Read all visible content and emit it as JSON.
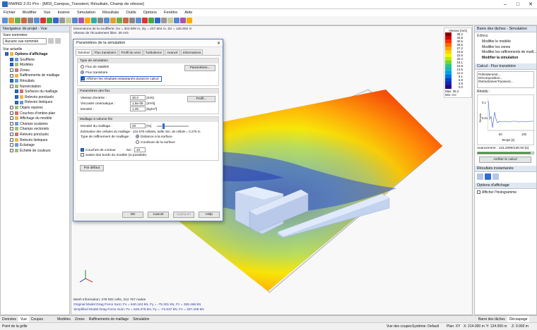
{
  "window": {
    "title": "RWIND 2.01 Pro - [M03_Campus_Transient, Résultats, Champ de vitesse]"
  },
  "menu": [
    "Fichier",
    "Modifier",
    "Vue",
    "Insérer",
    "Simulation",
    "Résultats",
    "Outils",
    "Options",
    "Fenêtre",
    "Aide"
  ],
  "left_panel": {
    "title": "Navigateur de projet - Vue",
    "saved_views_label": "Vues nommées",
    "saved_views_value": "Aucune vue nommée",
    "current_view_label": "Vue actuelle",
    "tree": [
      {
        "label": "Options d'affichage",
        "bold": true,
        "level": 0,
        "checked": true
      },
      {
        "label": "Soufflerie",
        "level": 1,
        "checked": true
      },
      {
        "label": "Modèles",
        "level": 1,
        "checked": true
      },
      {
        "label": "Zones",
        "level": 1,
        "checked": false
      },
      {
        "label": "Raffinements de maillage",
        "level": 1,
        "checked": false
      },
      {
        "label": "Résultats",
        "level": 1,
        "checked": true
      },
      {
        "label": "Numérotation",
        "level": 1,
        "checked": false
      },
      {
        "label": "Surfaces du maillage",
        "level": 2,
        "checked": true
      },
      {
        "label": "Relevés ponctuels",
        "level": 2,
        "checked": true
      },
      {
        "label": "Relevés linéiques",
        "level": 2,
        "checked": true
      },
      {
        "label": "Objets repères",
        "level": 1,
        "checked": false
      },
      {
        "label": "Couches d'ombre-plan",
        "level": 1,
        "checked": false
      },
      {
        "label": "Affichage du modèle",
        "level": 1,
        "checked": false
      },
      {
        "label": "Champs scalaires",
        "level": 1,
        "checked": false
      },
      {
        "label": "Champs vectoriels",
        "level": 1,
        "checked": false
      },
      {
        "label": "Relevés ponctuels",
        "level": 1,
        "checked": false
      },
      {
        "label": "Relevés linéiques",
        "level": 1,
        "checked": false
      },
      {
        "label": "Éclairage",
        "level": 1,
        "checked": false
      },
      {
        "label": "Échelle de couleurs",
        "level": 1,
        "checked": false
      }
    ]
  },
  "viewport": {
    "info1": "Dimensions de la soufflerie: Dx = 303.909 m, Dy = 207.604 m, Dz = 125.902 m",
    "info2": "Vitesse de l'écoulement libre: 30 m/s",
    "legend_title": "Vitesse [m/s]",
    "legend": [
      {
        "v": "36.2",
        "c": "#8b0000"
      },
      {
        "v": "34.8",
        "c": "#d40000"
      },
      {
        "v": "30.6",
        "c": "#ff2a00"
      },
      {
        "v": "29.5",
        "c": "#ff6a00"
      },
      {
        "v": "27.2",
        "c": "#ffa000"
      },
      {
        "v": "24.9",
        "c": "#ffd000"
      },
      {
        "v": "22.6",
        "c": "#f5f500"
      },
      {
        "v": "20.4",
        "c": "#b8e800"
      },
      {
        "v": "18.1",
        "c": "#6ad83a"
      },
      {
        "v": "15.8",
        "c": "#2cc48a"
      },
      {
        "v": "13.6",
        "c": "#18b4c8"
      },
      {
        "v": "11.3",
        "c": "#00a0e6"
      },
      {
        "v": "9.1",
        "c": "#0070e0"
      },
      {
        "v": "6.8",
        "c": "#0040d0"
      },
      {
        "v": "3.9",
        "c": "#1a20b0"
      },
      {
        "v": "0.0",
        "c": "#280088"
      }
    ],
    "legend_max": "Max:  36.2",
    "legend_min": "Min:  0.0",
    "bottom1": "Mesh information: 279 002 cells, 312 767 nodes",
    "bottom2": "Original Model Drag Force Sum: Fx = 640.163 kN, Fy = -75.301 kN, Fz = 326.468 kN",
    "bottom3": "Simplified Model Drag Force Sum: Fx = 625.378 kN, Fy = -74.637 kN, Fz = 337.209 kN"
  },
  "dialog": {
    "title": "Paramètres de la simulation",
    "tabs": [
      "Général",
      "Flux transitoire",
      "Profil du vent",
      "Turbulence",
      "Avancé",
      "Informations"
    ],
    "sim_type_header": "Type de simulation",
    "steady": "Flux de stabilité",
    "transient": "Flux transitoire",
    "params_button": "Paramètres...",
    "show_results": "Afficher les résultats instantanés durant le calcul",
    "flow_header": "Paramètres des flux",
    "speed_label": "Vitesse d'entrée :",
    "speed_val": "30.0",
    "speed_unit": "[m/s]",
    "profile_button": "Profil...",
    "visc_label": "Viscosité cinématique :",
    "visc_val": "1.5e-05",
    "visc_unit": "[m²/s]",
    "dens_label": "Densité :",
    "dens_val": "1.25",
    "dens_unit": "[kg/m³]",
    "mesh_header": "Maillage à volume fini",
    "mesh_density_label": "Densité du maillage :",
    "mesh_density_val": "20",
    "mesh_density_unit": "[%]",
    "estimation": "Estimation des cellules du maillage : 134 678 cellules, taille min. de cellule = 0.275 m",
    "refine_label": "Type de raffinement de maillage :",
    "refine_opt1": "Distance à la surface",
    "refine_opt2": "Courbure de la surface",
    "boundary_label": "Couches de contour",
    "nc_label": "NC :",
    "nc_val": "10",
    "consider_edges": "Saisie des bords du modèle (si possible)",
    "default_button": "Par défaut",
    "ok": "OK",
    "cancel": "Cancel",
    "apply": "Appliquer",
    "help": "Help"
  },
  "right_panel": {
    "title": "Barre des tâches - Simulation",
    "edit_header": "Éditeur",
    "edit_items": [
      "Modifier le modèle",
      "Modifier les zones",
      "Modifier les raffinements de maill...",
      "Modifier la simulation"
    ],
    "calc_header": "Calcul - Flux transitoire",
    "log": [
      "Prétraitement...",
      "Décomposition...",
      "RWindSolverTransient..."
    ],
    "residue_label": "Résidu :",
    "chart_ylabel": "Résidu",
    "chart_y1": "0,1",
    "chart_y2": "0,01",
    "chart_x1": "50",
    "chart_x2": "100",
    "chart_xlabel": "Temps [s]",
    "progress_label": "Avancement :",
    "progress_text": "123.2099/130.00 [s]",
    "progress": 0.948,
    "stop_button": "Arrêter le calcul",
    "instant_header": "Résultats instantanés",
    "display_header": "Options d'affichage",
    "histogram": "Afficher l'histogramme"
  },
  "bottom_tabs": [
    "Données",
    "Vue",
    "Coupes",
    "Modèles",
    "Zones",
    "Raffinements de maillage",
    "Simulation"
  ],
  "right_tabs": [
    "Barre des tâches",
    "Découpage"
  ],
  "status": {
    "left": "Point de la grille",
    "cuts": "Vue des coupes",
    "system": "Système: Default",
    "plan": "Plan: XY",
    "x": "X: 214.000 m",
    "y": "Y: 124.000 m",
    "z": "Z: 0.000 m"
  }
}
